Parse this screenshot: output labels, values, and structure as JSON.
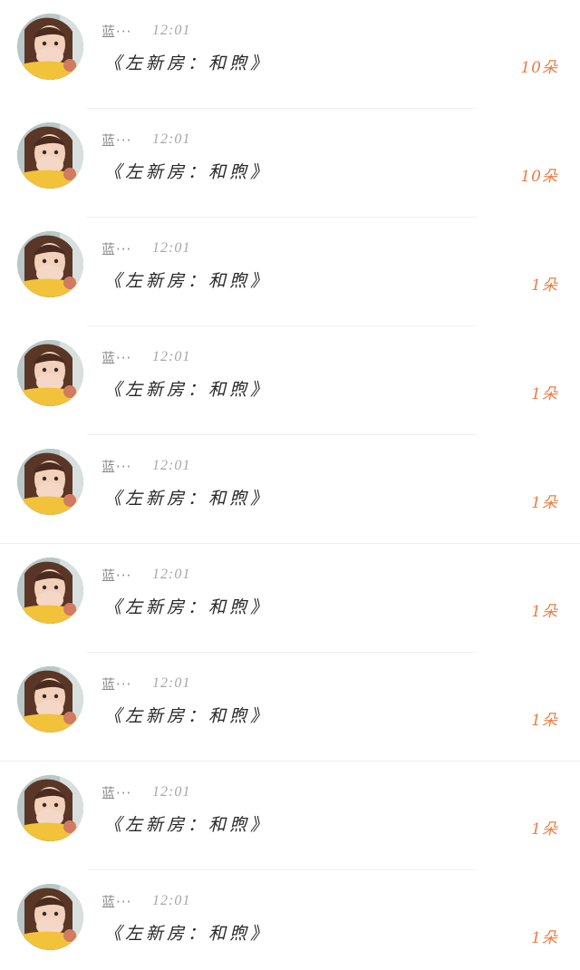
{
  "gift_list": {
    "items": [
      {
        "name": "蓝···",
        "time": "12:01",
        "message": "《左新房：和煦》",
        "count": "10朵"
      },
      {
        "name": "蓝···",
        "time": "12:01",
        "message": "《左新房：和煦》",
        "count": "10朵"
      },
      {
        "name": "蓝···",
        "time": "12:01",
        "message": "《左新房：和煦》",
        "count": "1朵"
      },
      {
        "name": "蓝···",
        "time": "12:01",
        "message": "《左新房：和煦》",
        "count": "1朵"
      },
      {
        "name": "蓝···",
        "time": "12:01",
        "message": "《左新房：和煦》",
        "count": "1朵"
      },
      {
        "name": "蓝···",
        "time": "12:01",
        "message": "《左新房：和煦》",
        "count": "1朵"
      },
      {
        "name": "蓝···",
        "time": "12:01",
        "message": "《左新房：和煦》",
        "count": "1朵"
      },
      {
        "name": "蓝···",
        "time": "12:01",
        "message": "《左新房：和煦》",
        "count": "1朵"
      },
      {
        "name": "蓝···",
        "time": "12:01",
        "message": "《左新房：和煦》",
        "count": "1朵"
      }
    ],
    "avatar_icon": "user-avatar-photo",
    "count_color": "#f07b3f"
  }
}
